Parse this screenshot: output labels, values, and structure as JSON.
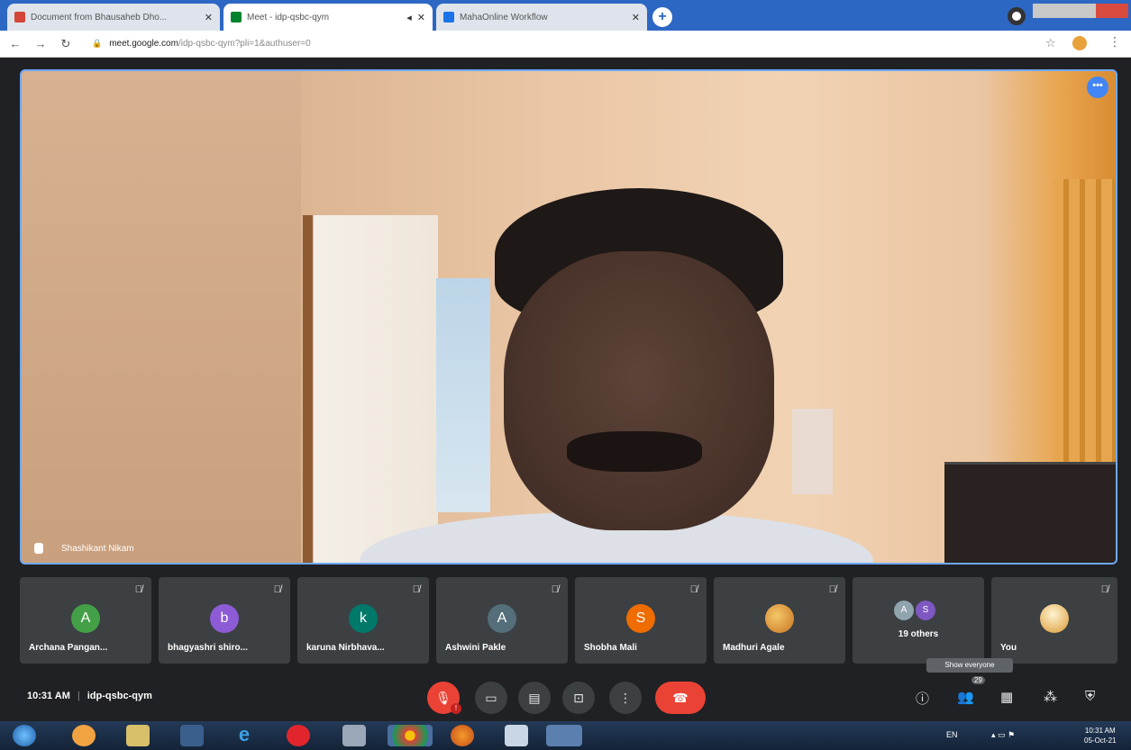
{
  "browser": {
    "tabs": [
      {
        "label": "Document from Bhausaheb Dho...",
        "favicon_color": "#d44638"
      },
      {
        "label": "Meet - idp-qsbc-qym",
        "favicon_color": "#00832d"
      },
      {
        "label": "MahaOnline Workflow",
        "favicon_color": "#1a73e8"
      }
    ],
    "url_host": "meet.google.com",
    "url_path": "/idp-qsbc-qym?pli=1&authuser=0"
  },
  "main_video": {
    "speaker_name": "Shashikant Nikam"
  },
  "participants": [
    {
      "name": "Archana Pangan...",
      "initial": "A",
      "color": "#43a047"
    },
    {
      "name": "bhagyashri shiro...",
      "initial": "b",
      "color": "#8e5bd6"
    },
    {
      "name": "karuna Nirbhava...",
      "initial": "k",
      "color": "#00796b"
    },
    {
      "name": "Ashwini Pakle",
      "initial": "A",
      "color": "#546e7a"
    },
    {
      "name": "Shobha Mali",
      "initial": "S",
      "color": "#ef6c00"
    },
    {
      "name": "Madhuri Agale",
      "initial": "",
      "color": "#e8a33a"
    }
  ],
  "others_tile": {
    "label": "19 others",
    "mini_initials": [
      "A",
      "S"
    ],
    "mini_colors": [
      "#90a4ae",
      "#7e57c2"
    ]
  },
  "self_tile": {
    "label": "You",
    "color": "#e8b04a"
  },
  "tooltip": "Show everyone",
  "meeting": {
    "time": "10:31 AM",
    "code": "idp-qsbc-qym",
    "people_count": "29"
  },
  "controls": {
    "mic_icon": "mic-off-icon",
    "camera_icon": "camera-icon",
    "captions_icon": "captions-icon",
    "present_icon": "present-icon",
    "more_icon": "more-icon",
    "hangup_icon": "hangup-icon"
  },
  "taskbar": {
    "lang": "EN",
    "clock_time": "10:31 AM",
    "clock_date": "05-Oct-21"
  },
  "colors": {
    "accent": "#4285f4",
    "danger": "#ea4335",
    "tile_bg": "#3c4043"
  }
}
